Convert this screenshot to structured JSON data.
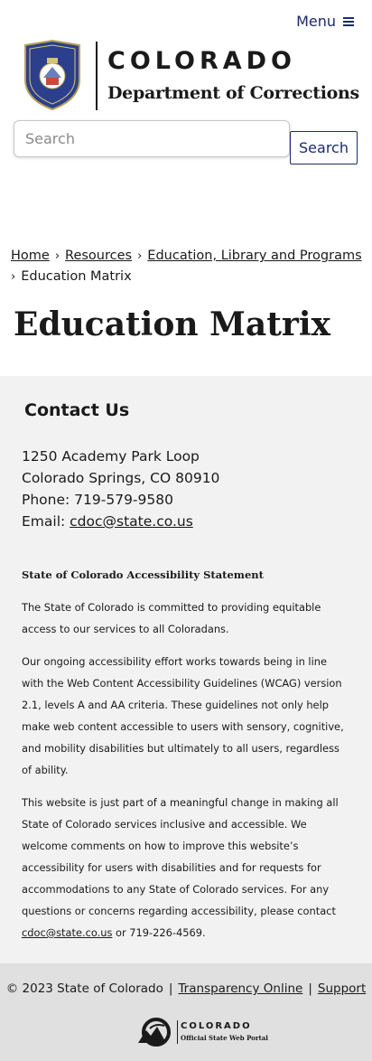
{
  "header": {
    "menu_label": "Menu",
    "logo_title": "COLORADO",
    "logo_subtitle": "Department of Corrections"
  },
  "search": {
    "placeholder": "Search",
    "button_label": "Search"
  },
  "breadcrumb": {
    "items": [
      "Home",
      "Resources",
      "Education, Library and Programs"
    ],
    "separator": "›",
    "current": "Education Matrix"
  },
  "page": {
    "title": "Education Matrix"
  },
  "contact": {
    "title": "Contact Us",
    "address_line1": "1250 Academy Park Loop",
    "address_line2": "Colorado Springs, CO 80910",
    "phone": "Phone: 719-579-9580",
    "email_label": "Email: ",
    "email": "cdoc@state.co.us"
  },
  "accessibility": {
    "heading": "State of Colorado Accessibility Statement",
    "p1": "The State of Colorado is committed to providing equitable access to our services to all Coloradans.",
    "p2": "Our ongoing accessibility effort works towards being in line with the Web Content Accessibility Guidelines (WCAG) version 2.1, levels A and AA criteria. These guidelines not only help make web content accessible to users with sensory, cognitive, and mobility disabilities but ultimately to all users, regardless of ability.",
    "p3_text": "This website is just part of a meaningful change in making all State of Colorado services inclusive and accessible. We welcome comments on how to improve this website’s accessibility for users with disabilities and for requests for accommodations to any State of Colorado services. For any questions or concerns regarding accessibility, please contact ",
    "p3_email": "cdoc@state.co.us",
    "p3_suffix": " or 719-226-4569."
  },
  "footer": {
    "copyright": "© 2023 State of Colorado",
    "pipe": "|",
    "link_transparency": "Transparency Online",
    "link_support": "Support",
    "portal_name": "COLORADO",
    "portal_sub": "Official State Web Portal"
  },
  "colors": {
    "brand_navy": "#1b2a6b",
    "grey_section": "#f2f2f2",
    "footer_bg": "#e0e0e0"
  },
  "icons": [
    "hamburger-menu-icon",
    "colorado-doc-seal",
    "colorado-portal-mark"
  ]
}
